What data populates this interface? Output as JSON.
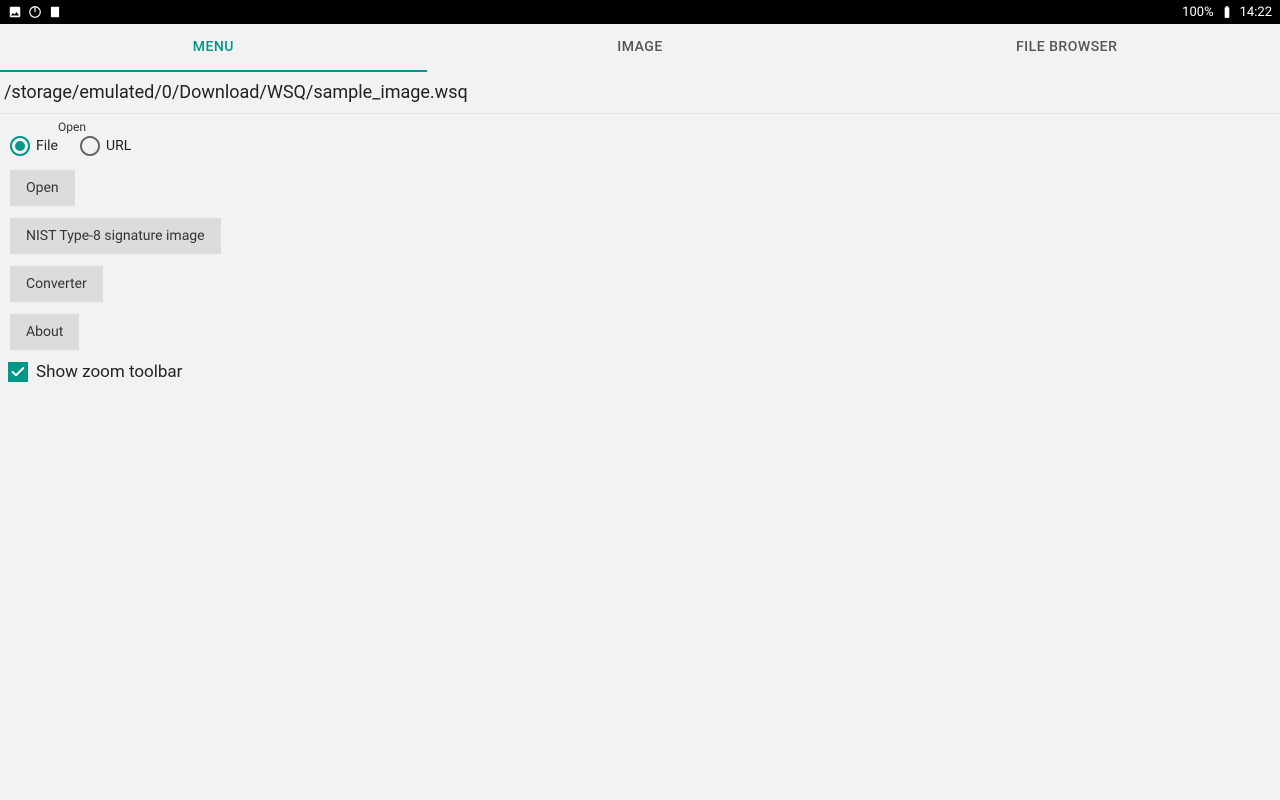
{
  "status": {
    "battery_pct": "100%",
    "time": "14:22"
  },
  "tabs": [
    {
      "label": "MENU",
      "active": true
    },
    {
      "label": "IMAGE",
      "active": false
    },
    {
      "label": "FILE BROWSER",
      "active": false
    }
  ],
  "path": "/storage/emulated/0/Download/WSQ/sample_image.wsq",
  "open": {
    "group_label": "Open",
    "options": [
      {
        "label": "File",
        "selected": true
      },
      {
        "label": "URL",
        "selected": false
      }
    ]
  },
  "buttons": {
    "open": "Open",
    "nist": "NIST Type-8 signature image",
    "converter": "Converter",
    "about": "About"
  },
  "zoom_toolbar": {
    "label": "Show zoom toolbar",
    "checked": true
  }
}
